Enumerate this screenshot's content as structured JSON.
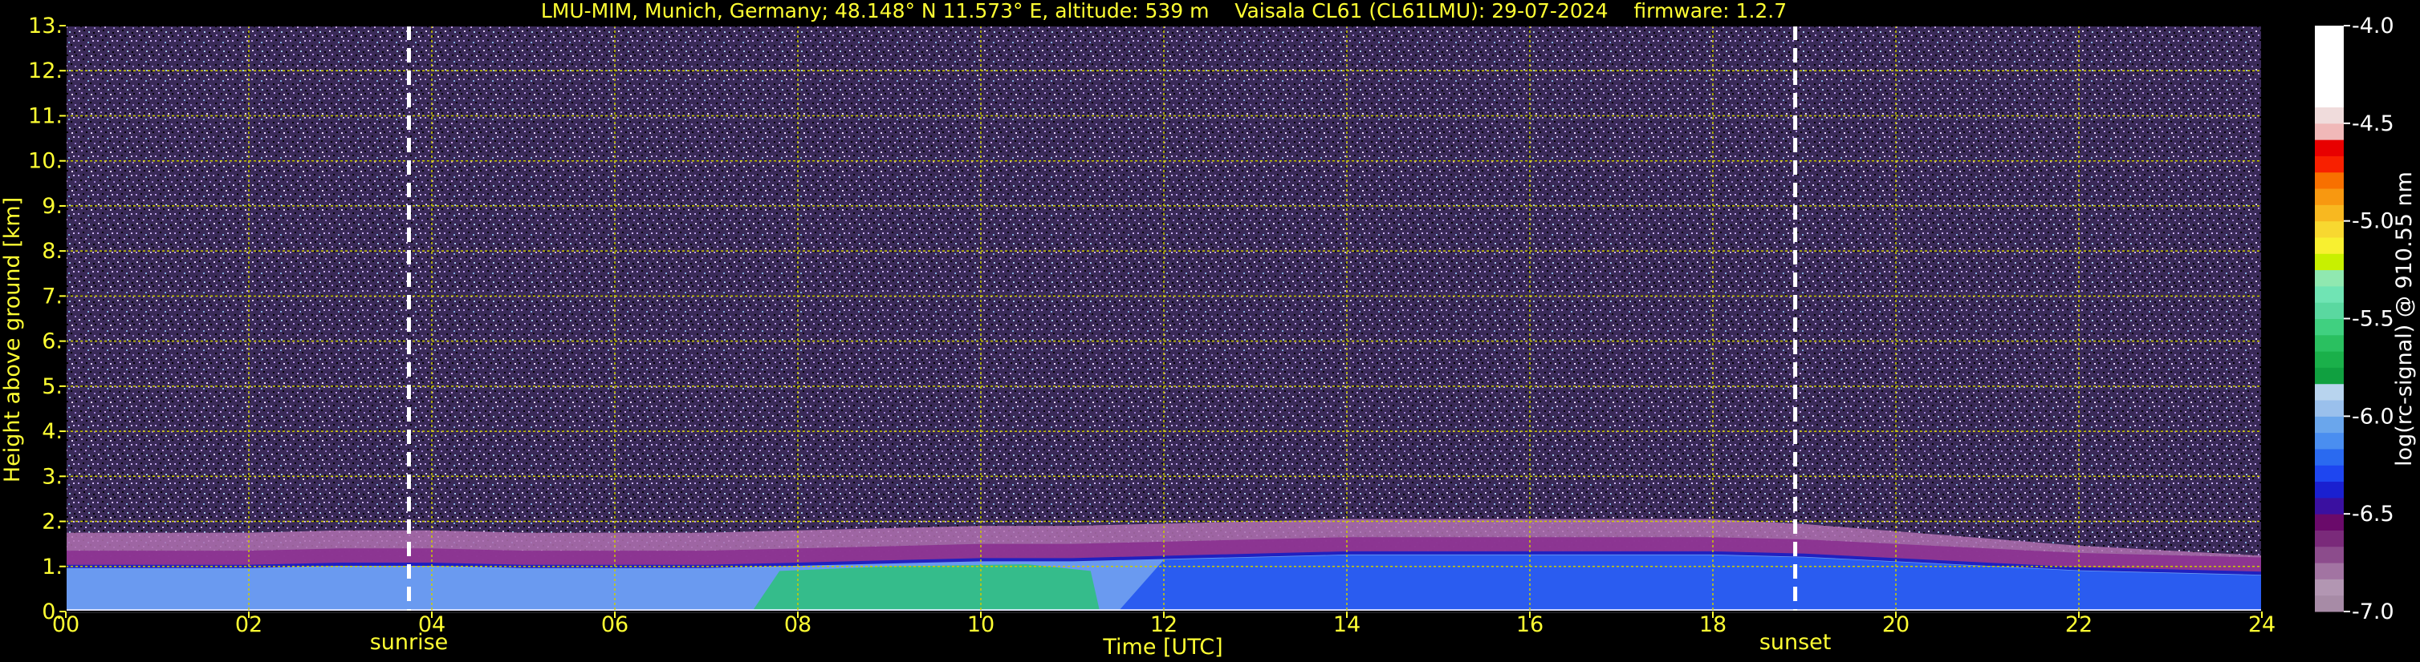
{
  "colors": {
    "background": "#000000",
    "text_yellow": "#ffff33",
    "grid_yellow": "#cccc00",
    "marker_white": "#ffffff",
    "colorbar_text": "#ffffff"
  },
  "chart_data": {
    "type": "heatmap",
    "title": "LMU-MIM, Munich, Germany; 48.148° N 11.573° E, altitude: 539 m    Vaisala CL61 (CL61LMU): 29-07-2024    firmware: 1.2.7",
    "xlabel": "Time [UTC]",
    "ylabel": "Height above ground [km]",
    "xlim": [
      0,
      24
    ],
    "ylim": [
      0,
      13
    ],
    "x_ticks": [
      0,
      2,
      4,
      6,
      8,
      10,
      12,
      14,
      16,
      18,
      20,
      22,
      24
    ],
    "x_tick_labels": [
      "00",
      "02",
      "04",
      "06",
      "08",
      "10",
      "12",
      "14",
      "16",
      "18",
      "20",
      "22",
      "24"
    ],
    "y_ticks": [
      0,
      1,
      2,
      3,
      4,
      5,
      6,
      7,
      8,
      9,
      10,
      11,
      12,
      13
    ],
    "y_tick_labels": [
      "0.",
      "1.",
      "2.",
      "3.",
      "4.",
      "5.",
      "6.",
      "7.",
      "8.",
      "9.",
      "10.",
      "11.",
      "12.",
      "13."
    ],
    "grid": true,
    "events": [
      {
        "label": "sunrise",
        "time": 3.75
      },
      {
        "label": "sunset",
        "time": 18.9
      }
    ],
    "boundary_layer_top_km": [
      [
        0,
        1.0
      ],
      [
        1,
        1.0
      ],
      [
        2,
        1.0
      ],
      [
        3,
        1.05
      ],
      [
        4,
        1.05
      ],
      [
        5,
        1.0
      ],
      [
        6,
        1.0
      ],
      [
        7,
        1.0
      ],
      [
        8,
        1.05
      ],
      [
        9,
        1.1
      ],
      [
        10,
        1.15
      ],
      [
        11,
        1.15
      ],
      [
        12,
        1.2
      ],
      [
        13,
        1.25
      ],
      [
        14,
        1.3
      ],
      [
        15,
        1.3
      ],
      [
        16,
        1.3
      ],
      [
        17,
        1.3
      ],
      [
        18,
        1.3
      ],
      [
        19,
        1.25
      ],
      [
        20,
        1.15
      ],
      [
        21,
        1.05
      ],
      [
        22,
        0.95
      ],
      [
        23,
        0.9
      ],
      [
        24,
        0.85
      ]
    ],
    "colorbar": {
      "label": "log(rc-signal) @ 910.55 nm",
      "min": -7.0,
      "max": -4.0,
      "ticks": [
        -4.0,
        -4.5,
        -5.0,
        -5.5,
        -6.0,
        -6.5,
        -7.0
      ],
      "tick_labels": [
        "-4.0",
        "-4.5",
        "-5.0",
        "-5.5",
        "-6.0",
        "-6.5",
        "-7.0"
      ],
      "colors": [
        "#a78ba6",
        "#b296b2",
        "#a274a2",
        "#8c4c8c",
        "#7a2a7a",
        "#6a0a6a",
        "#3a10a0",
        "#1a20d0",
        "#1e46f0",
        "#2a6af0",
        "#4a8ef0",
        "#6aa6ec",
        "#9ac0ec",
        "#b8d4ee",
        "#10a040",
        "#1ab04a",
        "#2ac060",
        "#40d080",
        "#5ad8a0",
        "#70e4b4",
        "#90e8b0",
        "#c8f000",
        "#f8f030",
        "#f8d830",
        "#f8b820",
        "#f89810",
        "#f87000",
        "#f82000",
        "#e80000",
        "#f0b8b8",
        "#f0dcdc",
        "#ffffff",
        "#ffffff",
        "#ffffff",
        "#ffffff",
        "#ffffff"
      ]
    }
  }
}
